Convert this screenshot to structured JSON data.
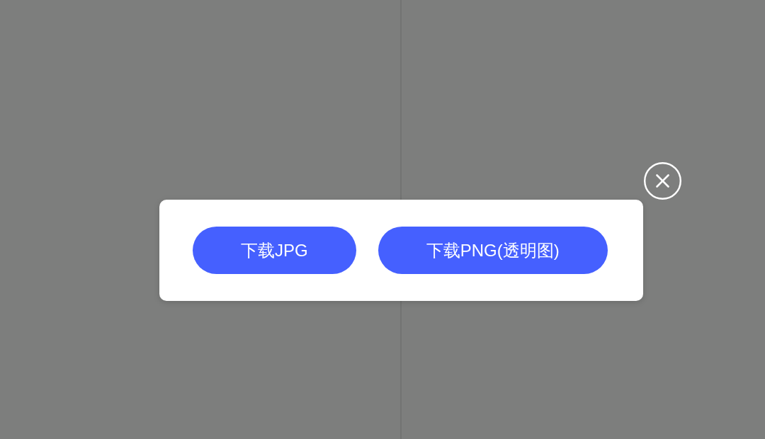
{
  "dialog": {
    "buttons": [
      {
        "label": "下载JPG"
      },
      {
        "label": "下载PNG(透明图)"
      }
    ]
  }
}
